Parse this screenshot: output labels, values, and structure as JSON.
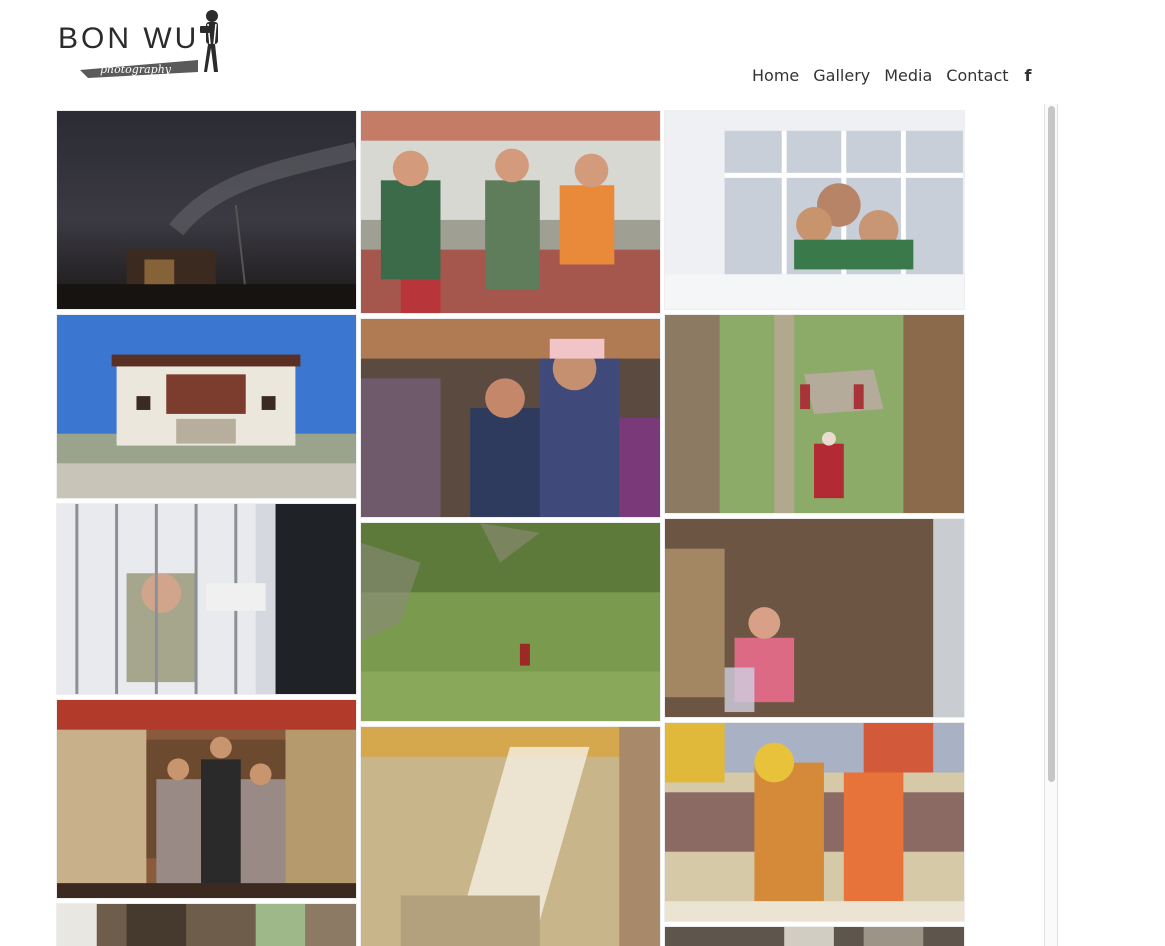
{
  "brand": {
    "name": "BON WU",
    "tagline": "photography"
  },
  "nav": {
    "items": [
      {
        "label": "Home"
      },
      {
        "label": "Gallery"
      },
      {
        "label": "Media"
      },
      {
        "label": "Contact"
      }
    ],
    "social_icon": "facebook-icon",
    "social_glyph": "f"
  },
  "colors": {
    "text": "#333333",
    "scrollbar_thumb": "#c6c6c6"
  },
  "gallery": {
    "photos": [
      {
        "subject": "night sky with milky way over house"
      },
      {
        "subject": "three children sitting in tent"
      },
      {
        "subject": "family smiling through window"
      },
      {
        "subject": "white monastery under blue sky"
      },
      {
        "subject": "elderly woman and girl in crowd"
      },
      {
        "subject": "monks on green hillside through window"
      },
      {
        "subject": "girl behind window bars"
      },
      {
        "subject": "red-robed figure on grassy slope"
      },
      {
        "subject": "child in pink jacket in mud pit"
      },
      {
        "subject": "children posing in colorful temple"
      },
      {
        "subject": "beam of light in temple interior"
      },
      {
        "subject": "masked dancers in festival"
      },
      {
        "subject": "doorway of old house"
      },
      {
        "subject": "street scene"
      }
    ]
  }
}
